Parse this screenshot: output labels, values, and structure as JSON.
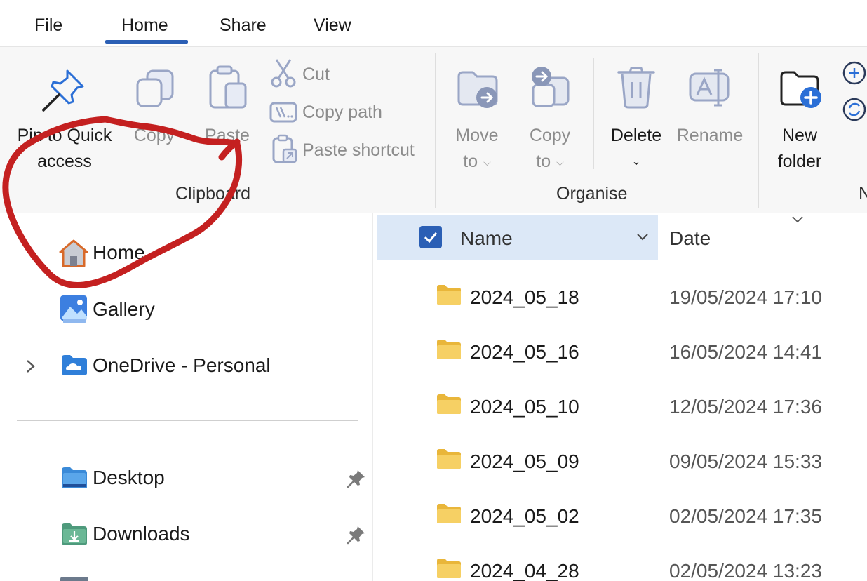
{
  "menu": {
    "tabs": [
      {
        "label": "File"
      },
      {
        "label": "Home"
      },
      {
        "label": "Share"
      },
      {
        "label": "View"
      }
    ],
    "active": "Home"
  },
  "ribbon": {
    "clipboard": {
      "group_label": "Clipboard",
      "pin_line1": "Pin to Quick",
      "pin_line2": "access",
      "copy": "Copy",
      "paste": "Paste",
      "cut": "Cut",
      "copy_path": "Copy path",
      "paste_shortcut": "Paste shortcut"
    },
    "organise": {
      "group_label": "Organise",
      "move_line1": "Move",
      "move_line2": "to",
      "copyto_line1": "Copy",
      "copyto_line2": "to",
      "delete": "Delete",
      "rename": "Rename"
    },
    "new": {
      "group_label_partial": "N",
      "new_folder_line1": "New",
      "new_folder_line2": "folder"
    }
  },
  "nav": {
    "items": [
      {
        "label": "Home",
        "icon": "home-icon"
      },
      {
        "label": "Gallery",
        "icon": "gallery-icon"
      },
      {
        "label": "OneDrive - Personal",
        "icon": "onedrive-icon"
      },
      {
        "label": "Desktop",
        "icon": "desktop-folder-icon",
        "pinned": true
      },
      {
        "label": "Downloads",
        "icon": "downloads-folder-icon",
        "pinned": true
      }
    ]
  },
  "filelist": {
    "columns": {
      "name": "Name",
      "date": "Date"
    },
    "rows": [
      {
        "name": "2024_05_18",
        "date": "19/05/2024 17:10"
      },
      {
        "name": "2024_05_16",
        "date": "16/05/2024 14:41"
      },
      {
        "name": "2024_05_10",
        "date": "12/05/2024 17:36"
      },
      {
        "name": "2024_05_09",
        "date": "09/05/2024 15:33"
      },
      {
        "name": "2024_05_02",
        "date": "02/05/2024 17:35"
      },
      {
        "name": "2024_04_28",
        "date": "02/05/2024 13:23"
      }
    ]
  },
  "colors": {
    "accent": "#2b5fb5",
    "header_selected": "#dce8f7",
    "annotation": "#c42020",
    "folder": "#f3c84a",
    "disabled_icon": "#9aa6c6"
  }
}
